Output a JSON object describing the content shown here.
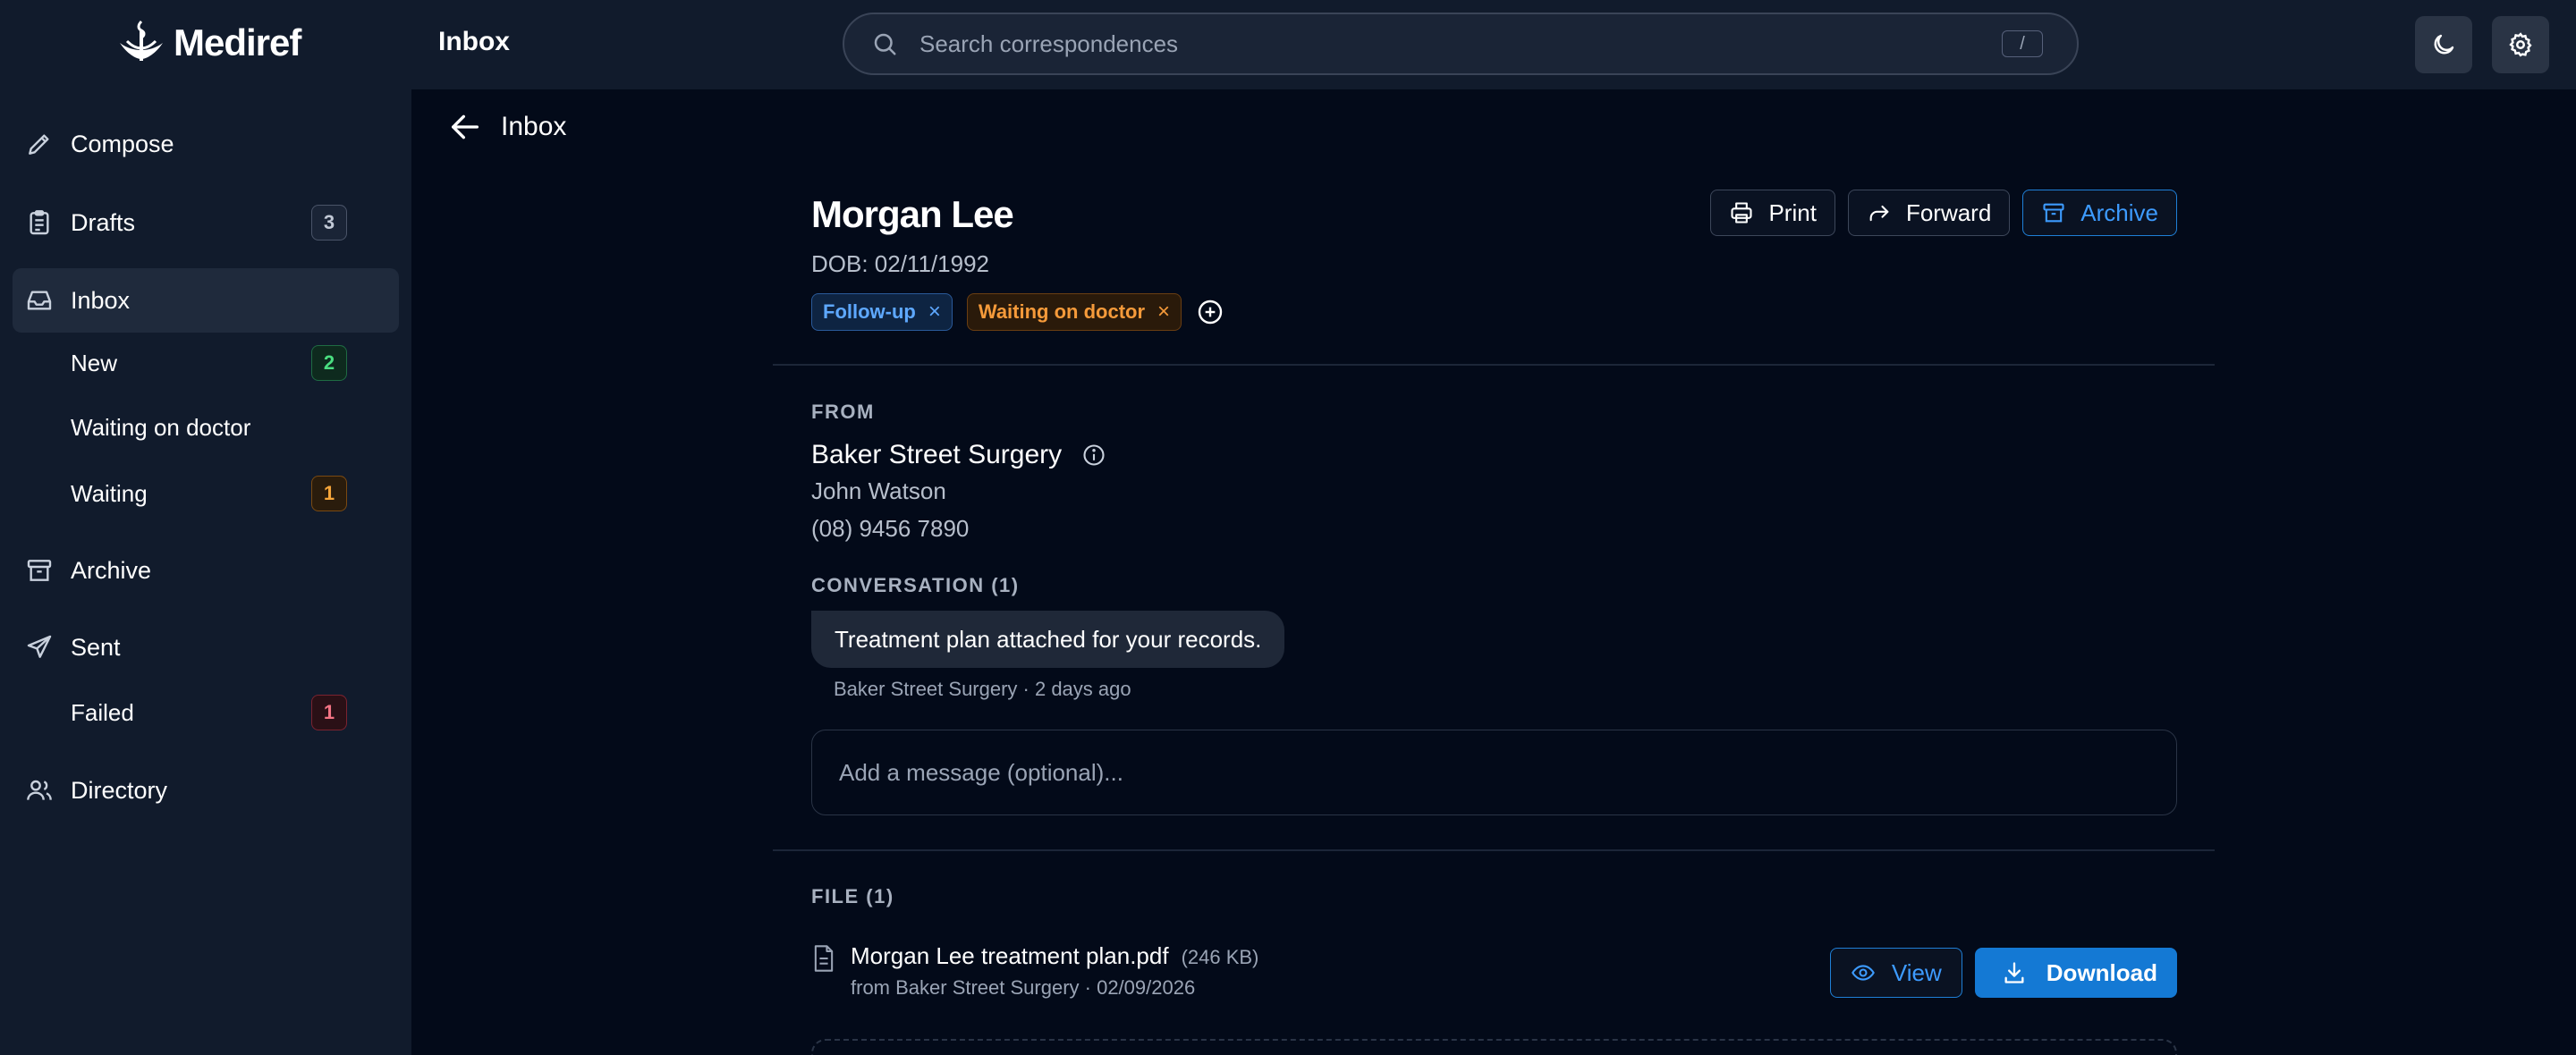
{
  "app": {
    "name": "Mediref",
    "page_title": "Inbox"
  },
  "search": {
    "placeholder": "Search correspondences",
    "shortcut": "/"
  },
  "header": {
    "theme_icon": "moon-icon",
    "settings_icon": "gear-icon"
  },
  "sidebar": {
    "compose": {
      "label": "Compose",
      "icon": "pencil-icon"
    },
    "drafts": {
      "label": "Drafts",
      "icon": "clipboard-icon",
      "count": "3"
    },
    "inbox": {
      "label": "Inbox",
      "icon": "inbox-icon"
    },
    "inbox_sub": [
      {
        "label": "New",
        "count": "2"
      },
      {
        "label": "Waiting on doctor",
        "count": ""
      },
      {
        "label": "Waiting",
        "count": "1"
      }
    ],
    "archive": {
      "label": "Archive",
      "icon": "archive-icon"
    },
    "sent": {
      "label": "Sent",
      "icon": "send-icon"
    },
    "sent_sub": [
      {
        "label": "Failed",
        "count": "1"
      }
    ],
    "directory": {
      "label": "Directory",
      "icon": "users-icon"
    }
  },
  "detail": {
    "back_label": "Inbox",
    "patient_name": "Morgan Lee",
    "dob": "DOB: 02/11/1992",
    "tags": [
      {
        "label": "Follow-up",
        "color": "#5ea8ff"
      },
      {
        "label": "Waiting on doctor",
        "color": "#f59a3a"
      }
    ],
    "tag_remove": "×",
    "actions": {
      "print": "Print",
      "forward": "Forward",
      "archive": "Archive"
    },
    "from": {
      "section_label": "FROM",
      "practice": "Baker Street Surgery",
      "doctor": "John Watson",
      "phone": "(08) 9456 7890"
    },
    "conversation": {
      "section_label": "CONVERSATION (1)",
      "messages": [
        {
          "text": "Treatment plan attached for your records.",
          "meta": "Baker Street Surgery · 2 days ago"
        }
      ],
      "input_placeholder": "Add a message (optional)..."
    },
    "files": {
      "section_label": "FILE (1)",
      "items": [
        {
          "name": "Morgan Lee treatment plan.pdf",
          "size": "(246 KB)",
          "meta": "from Baker Street Surgery · 02/09/2026",
          "view_label": "View",
          "download_label": "Download"
        }
      ]
    }
  },
  "colors": {
    "accent": "#1479d4",
    "background": "#030a19",
    "sidebar": "#111b2c"
  }
}
